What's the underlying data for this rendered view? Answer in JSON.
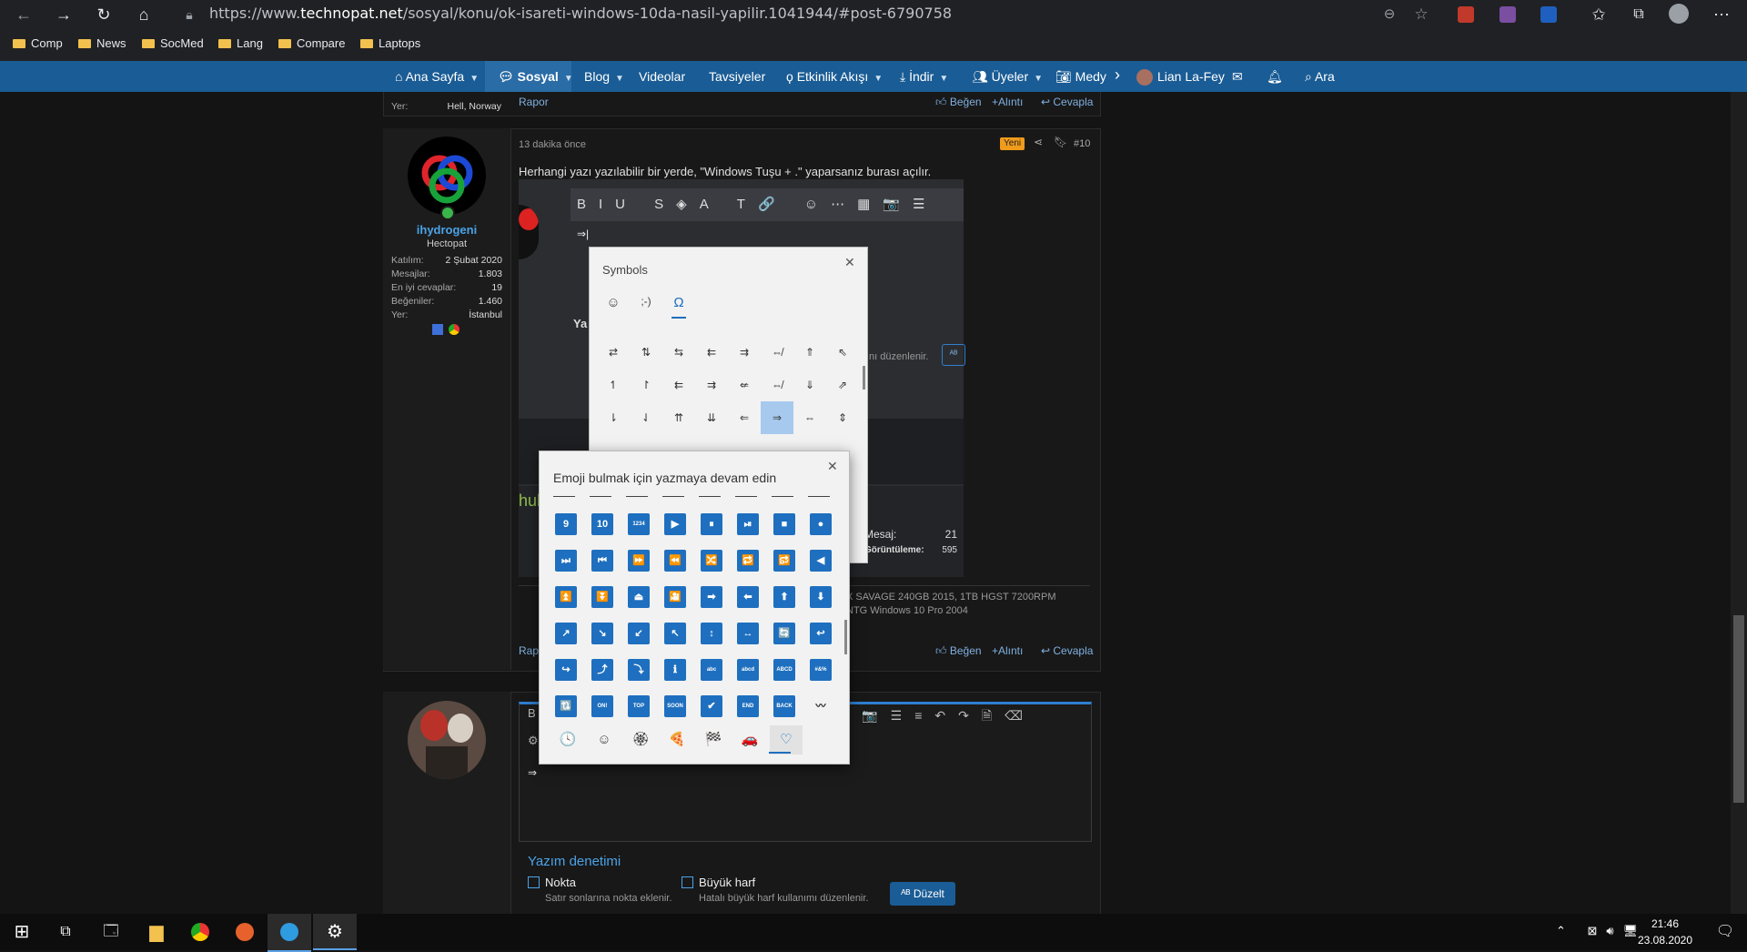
{
  "browser": {
    "url_prefix": "https://www.",
    "url_domain": "technopat.net",
    "url_path": "/sosyal/konu/ok-isareti-windows-10da-nasil-yapilir.1041944/#post-6790758",
    "bookmarks": [
      "Comp",
      "News",
      "SocMed",
      "Lang",
      "Compare",
      "Laptops"
    ]
  },
  "sitenav": {
    "items": [
      "Ana Sayfa",
      "Sosyal",
      "Blog",
      "Videolar",
      "Tavsiyeler",
      "Etkinlik Akışı",
      "İndir",
      "Üyeler",
      "Medy"
    ],
    "user": "Lian La-Fey",
    "search": "Ara"
  },
  "prev_post": {
    "location_label": "Yer:",
    "location": "Hell, Norway",
    "report": "Rapor",
    "like": "Beğen",
    "quote": "+Alıntı",
    "reply": "Cevapla"
  },
  "post": {
    "time": "13 dakika önce",
    "badge": "Yeni",
    "number": "#10",
    "username": "ihydrogeni",
    "rank": "Hectopat",
    "stats": [
      {
        "label": "Katılım:",
        "value": "2 Şubat 2020"
      },
      {
        "label": "Mesajlar:",
        "value": "1.803"
      },
      {
        "label": "En iyi cevaplar:",
        "value": "19"
      },
      {
        "label": "Beğeniler:",
        "value": "1.460"
      },
      {
        "label": "Yer:",
        "value": "İstanbul"
      }
    ],
    "body": "Herhangi yazı yazılabilir bir yerde, \"Windows Tuşu + .\" yaparsanız burası açılır.",
    "embedded_stats": [
      {
        "label": "Mesaj:",
        "value": "21"
      },
      {
        "label": "Görüntüleme:",
        "value": "595"
      }
    ],
    "embedded_hint": "ını düzenlenir.",
    "signature_line1": "X SAVAGE 240GB 2015, 1TB HGST 7200RPM",
    "signature_line2": "NTG Windows 10 Pro 2004",
    "report": "Rapor",
    "like": "Beğen",
    "quote": "+Alıntı",
    "reply": "Cevapla"
  },
  "reply_editor": {
    "content": "⇒",
    "spell_title": "Yazım denetimi",
    "opt1_label": "Nokta",
    "opt1_desc": "Satır sonlarına nokta eklenir.",
    "opt2_label": "Büyük harf",
    "opt2_desc": "Hatalı büyük harf kullanımı düzenlenir.",
    "fix_button": "Düzelt"
  },
  "symbols_panel": {
    "title": "Symbols",
    "tabs": [
      "☺",
      ";-)",
      "Ω"
    ],
    "grid": [
      [
        "⇄",
        "⇅",
        "⇆",
        "⇇",
        "⇉",
        "⇎",
        "⇑",
        "⇖"
      ],
      [
        "↿",
        "↾",
        "⇇",
        "⇉",
        "⇍",
        "⇎",
        "⇓",
        "⇗"
      ],
      [
        "⇂",
        "⇃",
        "⇈",
        "⇊",
        "⇐",
        "⇒",
        "⇔",
        "⇕"
      ]
    ]
  },
  "emoji_panel": {
    "search_hint": "Emoji bulmak için yazmaya devam edin",
    "grid": [
      [
        "9",
        "10",
        "1234",
        "▶",
        "⏸",
        "⏯",
        "■",
        "●"
      ],
      [
        "⏭",
        "⏮",
        "⏩",
        "⏪",
        "🔀",
        "🔁",
        "🔂",
        "◀"
      ],
      [
        "⏫",
        "⏬",
        "⏏",
        "🎦",
        "➡",
        "⬅",
        "⬆",
        "⬇"
      ],
      [
        "↗",
        "↘",
        "↙",
        "↖",
        "↕",
        "↔",
        "🔄",
        "↩"
      ],
      [
        "↪",
        "⤴",
        "⤵",
        "ℹ",
        "abc",
        "abcd",
        "ABCD",
        "#&%"
      ],
      [
        "🔃",
        "ON!",
        "TOP",
        "SOON",
        "✔",
        "END",
        "BACK",
        "〰"
      ]
    ],
    "categories": [
      "🕓",
      "☺",
      "🏵",
      "🍕",
      "🏁",
      "🚗",
      "♡"
    ]
  },
  "taskbar": {
    "time": "21:46",
    "date": "23.08.2020"
  }
}
